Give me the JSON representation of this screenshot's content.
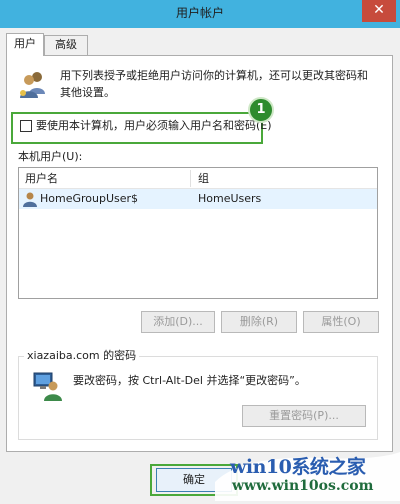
{
  "window": {
    "title": "用户帐户",
    "close_glyph": "✕"
  },
  "tabs": [
    {
      "label": "用户",
      "active": true
    },
    {
      "label": "高级",
      "active": false
    }
  ],
  "intro_text": "用下列表授予或拒绝用户访问你的计算机，还可以更改其密码和其他设置。",
  "require_login": {
    "label": "要使用本计算机，用户必须输入用户名和密码(E)",
    "checked": false,
    "badge": "1"
  },
  "users_list": {
    "label": "本机用户(U):",
    "columns": [
      "用户名",
      "组"
    ],
    "rows": [
      {
        "user": "HomeGroupUser$",
        "group": "HomeUsers",
        "selected": true
      }
    ]
  },
  "list_buttons": {
    "add": "添加(D)...",
    "remove": "删除(R)",
    "properties": "属性(O)"
  },
  "password_group": {
    "title": "xiazaiba.com 的密码",
    "text": "要改密码，按 Ctrl-Alt-Del 并选择“更改密码”。",
    "reset_button": "重置密码(P)..."
  },
  "footer": {
    "ok_button": "确定"
  },
  "watermark": {
    "title": "win10系统之家",
    "url": "www.win10os.com"
  },
  "colors": {
    "titlebar": "#41b2df",
    "close": "#c74b3c",
    "highlight": "#4aa83a"
  }
}
